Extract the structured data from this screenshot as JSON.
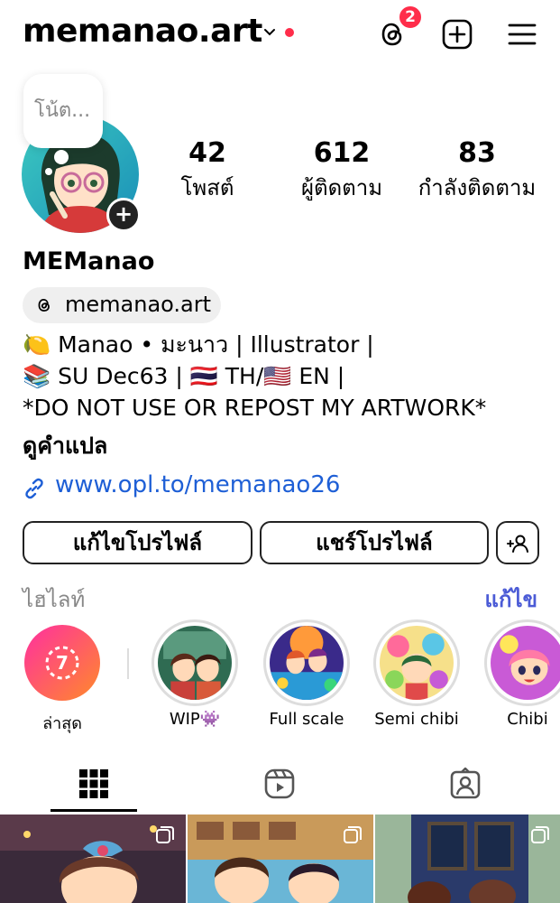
{
  "header": {
    "username": "memanao.art",
    "notification_count": "2",
    "icons": [
      "chevron-down-icon",
      "threads-icon",
      "add-post-icon",
      "menu-icon"
    ]
  },
  "profile": {
    "note_text": "โน้ต...",
    "stats": {
      "posts": {
        "value": "42",
        "label": "โพสต์"
      },
      "followers": {
        "value": "612",
        "label": "ผู้ติดตาม"
      },
      "following": {
        "value": "83",
        "label": "กำลังติดตาม"
      }
    },
    "display_name": "MEManao",
    "threads_handle": "memanao.art",
    "bio_lines": [
      "🍋 Manao • มะนาว | Illustrator |",
      "📚 SU Dec63 | 🇹🇭 TH/🇺🇸 EN |",
      "*DO NOT USE OR REPOST MY ARTWORK*"
    ],
    "see_translation": "ดูคำแปล",
    "link": "www.opl.to/memanao26"
  },
  "actions": {
    "edit_profile": "แก้ไขโปรไฟล์",
    "share_profile": "แชร์โปรไฟล์"
  },
  "highlights": {
    "title": "ไฮไลท์",
    "edit": "แก้ไข",
    "items": [
      {
        "label": "ล่าสุด"
      },
      {
        "label": "WIP👾"
      },
      {
        "label": "Full scale"
      },
      {
        "label": "Semi chibi"
      },
      {
        "label": "Chibi"
      }
    ]
  },
  "colors": {
    "accent_red": "#ff2d4a",
    "link_blue": "#1e5fd6",
    "edit_purple": "#4b5bd6"
  }
}
